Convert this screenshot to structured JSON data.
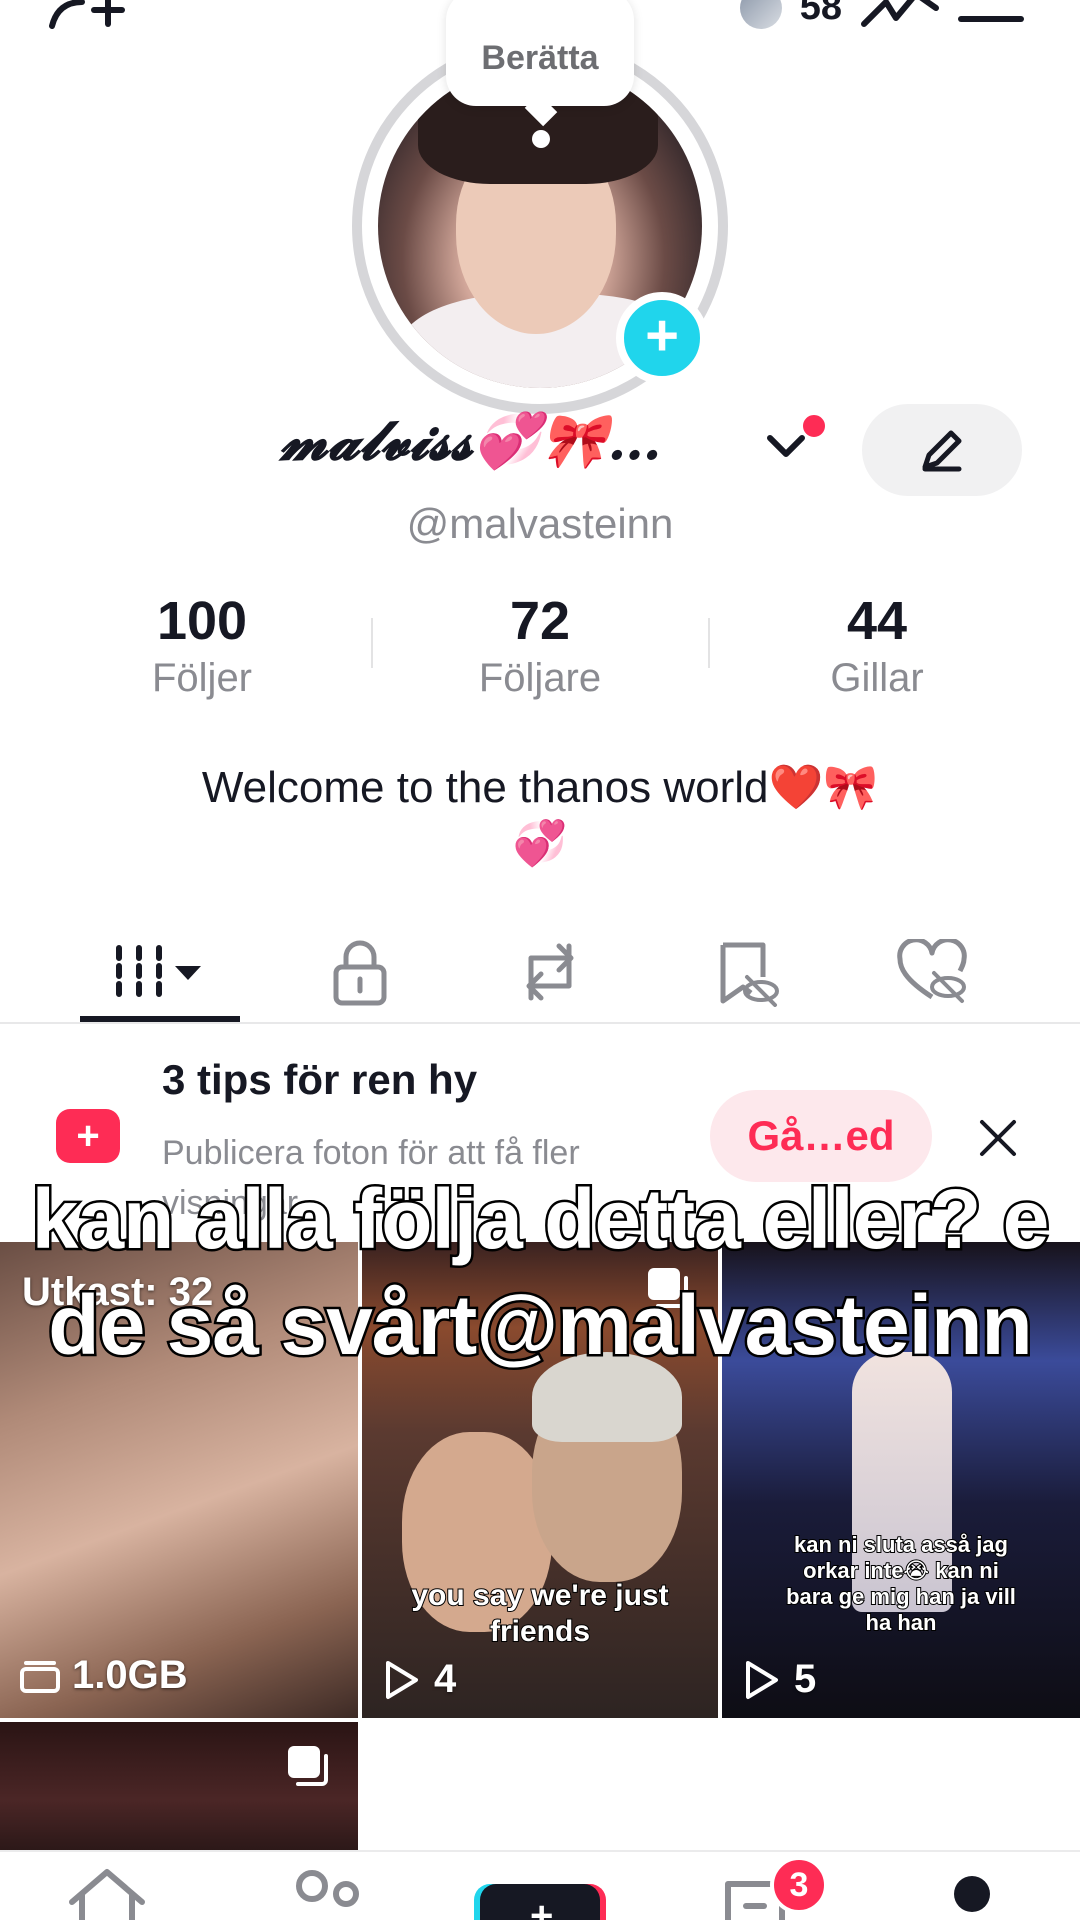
{
  "topbar": {
    "story_count": "58",
    "icons": [
      "add-friend-icon",
      "trend-icon",
      "menu-icon"
    ]
  },
  "profile": {
    "story_prompt": "Berätta",
    "display_name": "𝓶𝓪𝓵𝓿𝓲𝓼𝓼💞🎀…",
    "username": "@malvasteinn",
    "bio_line1": "Welcome to the thanos world❤️🎀",
    "bio_line2": "💞"
  },
  "stats": [
    {
      "value": "100",
      "label": "Följer"
    },
    {
      "value": "72",
      "label": "Följare"
    },
    {
      "value": "44",
      "label": "Gillar"
    }
  ],
  "tabs": [
    "videos-grid-icon",
    "lock-icon",
    "repost-icon",
    "favorites-hidden-icon",
    "liked-hidden-icon"
  ],
  "tips": {
    "title": "3 tips för ren hy",
    "subtitle": "Publicera foton för att få fler visningar",
    "button": "Gå…ed"
  },
  "grid": {
    "drafts_label": "Utkast: 32",
    "storage": "1.0GB",
    "tile2_caption": "you say we're just friends",
    "tile2_views": "4",
    "tile3_caption": "kan ni sluta asså jag orkar inte😭 kan ni bara ge mig han ja vill ha han",
    "tile3_views": "5"
  },
  "overlay_text": "kan alla följa detta eller? e de så svårt@malvasteinn",
  "bottomnav": {
    "items": [
      "home-icon",
      "friends-icon",
      "create-icon",
      "inbox-icon",
      "profile-icon"
    ],
    "inbox_badge": "3"
  },
  "colors": {
    "accent_pink": "#fe2c55",
    "accent_cyan": "#20d5ec",
    "text_primary": "#161823",
    "text_secondary": "#8a8b91"
  }
}
